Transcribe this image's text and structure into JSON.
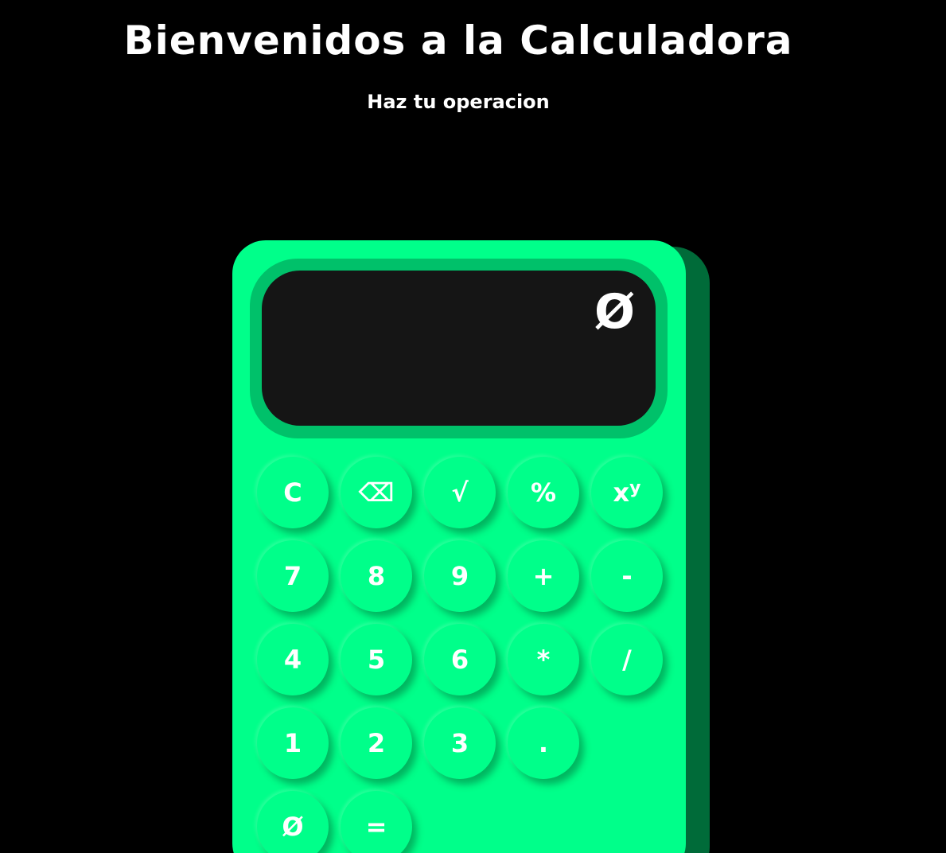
{
  "header": {
    "title": "Bienvenidos a la Calculadora",
    "subtitle": "Haz tu operacion"
  },
  "calculator": {
    "display_value": "Ø",
    "keys": {
      "clear": "C",
      "backspace": "⌫",
      "sqrt": "√",
      "percent": "%",
      "power_base": "x",
      "power_exp": "y",
      "seven": "7",
      "eight": "8",
      "nine": "9",
      "plus": "+",
      "minus": "-",
      "four": "4",
      "five": "5",
      "six": "6",
      "multiply": "*",
      "divide": "/",
      "one": "1",
      "two": "2",
      "three": "3",
      "decimal": ".",
      "zero": "Ø",
      "equals": "="
    }
  },
  "colors": {
    "background": "#000000",
    "calculator_body": "#00ff8a",
    "calculator_side": "#006b39",
    "screen_frame": "#00c16a",
    "screen": "#151515",
    "text": "#ffffff"
  }
}
